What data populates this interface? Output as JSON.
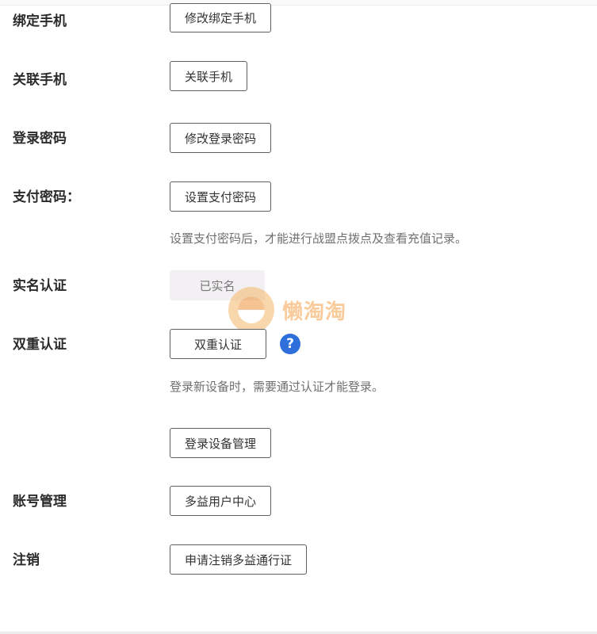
{
  "rows": {
    "bind_phone": {
      "label": "绑定手机",
      "button": "修改绑定手机"
    },
    "link_phone": {
      "label": "关联手机",
      "button": "关联手机"
    },
    "login_password": {
      "label": "登录密码",
      "button": "修改登录密码"
    },
    "pay_password": {
      "label": "支付密码：",
      "button": "设置支付密码",
      "hint": "设置支付密码后，才能进行战盟点拨点及查看充值记录。"
    },
    "real_name": {
      "label": "实名认证",
      "button": "已实名"
    },
    "two_factor": {
      "label": "双重认证",
      "button": "双重认证",
      "help_icon": "?",
      "hint": "登录新设备时，需要通过认证才能登录。"
    },
    "device_management": {
      "button": "登录设备管理"
    },
    "account_management": {
      "label": "账号管理",
      "button": "多益用户中心"
    },
    "cancel_account": {
      "label": "注销",
      "button": "申请注销多益通行证"
    }
  },
  "watermark": {
    "text": "懒淘淘"
  },
  "colors": {
    "help_icon": "#2f6fdb",
    "disabled_button_bg": "#f3f0f3",
    "watermark": "#f5a24a"
  }
}
